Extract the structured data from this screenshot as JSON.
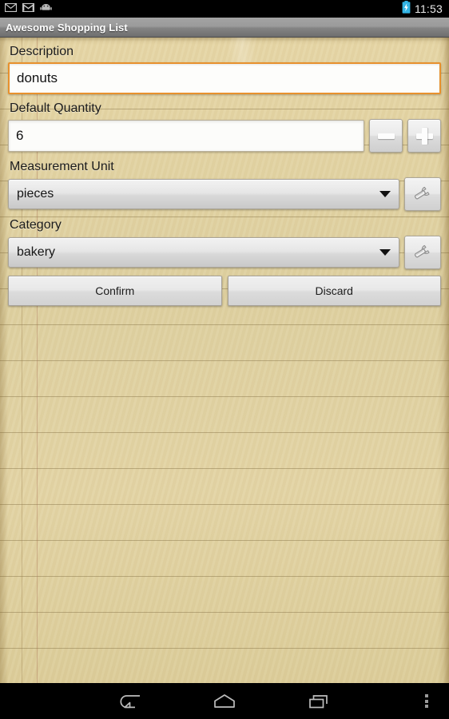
{
  "statusbar": {
    "icons": [
      {
        "name": "email-icon",
        "label": "Email"
      },
      {
        "name": "gmail-icon",
        "label": "Gmail"
      },
      {
        "name": "android-robot-icon",
        "label": "Android"
      }
    ],
    "battery": {
      "name": "battery-charging-icon",
      "color": "#33b5e5"
    },
    "time": "11:53"
  },
  "titlebar": {
    "title": "Awesome Shopping List"
  },
  "form": {
    "description": {
      "label": "Description",
      "value": "donuts",
      "focused": true,
      "focus_color": "#e8912d"
    },
    "quantity": {
      "label": "Default Quantity",
      "value": "6",
      "decrement": {
        "name": "minus-icon",
        "label": "−"
      },
      "increment": {
        "name": "plus-icon",
        "label": "+"
      }
    },
    "measurement_unit": {
      "label": "Measurement Unit",
      "value": "pieces",
      "edit_button": {
        "name": "wrench-icon",
        "label": "Edit measurement units"
      }
    },
    "category": {
      "label": "Category",
      "value": "bakery",
      "edit_button": {
        "name": "wrench-icon",
        "label": "Edit categories"
      }
    },
    "actions": {
      "confirm": "Confirm",
      "discard": "Discard"
    }
  },
  "navbar": {
    "back": "Back",
    "home": "Home",
    "recents": "Recent apps",
    "menu": "More options"
  }
}
